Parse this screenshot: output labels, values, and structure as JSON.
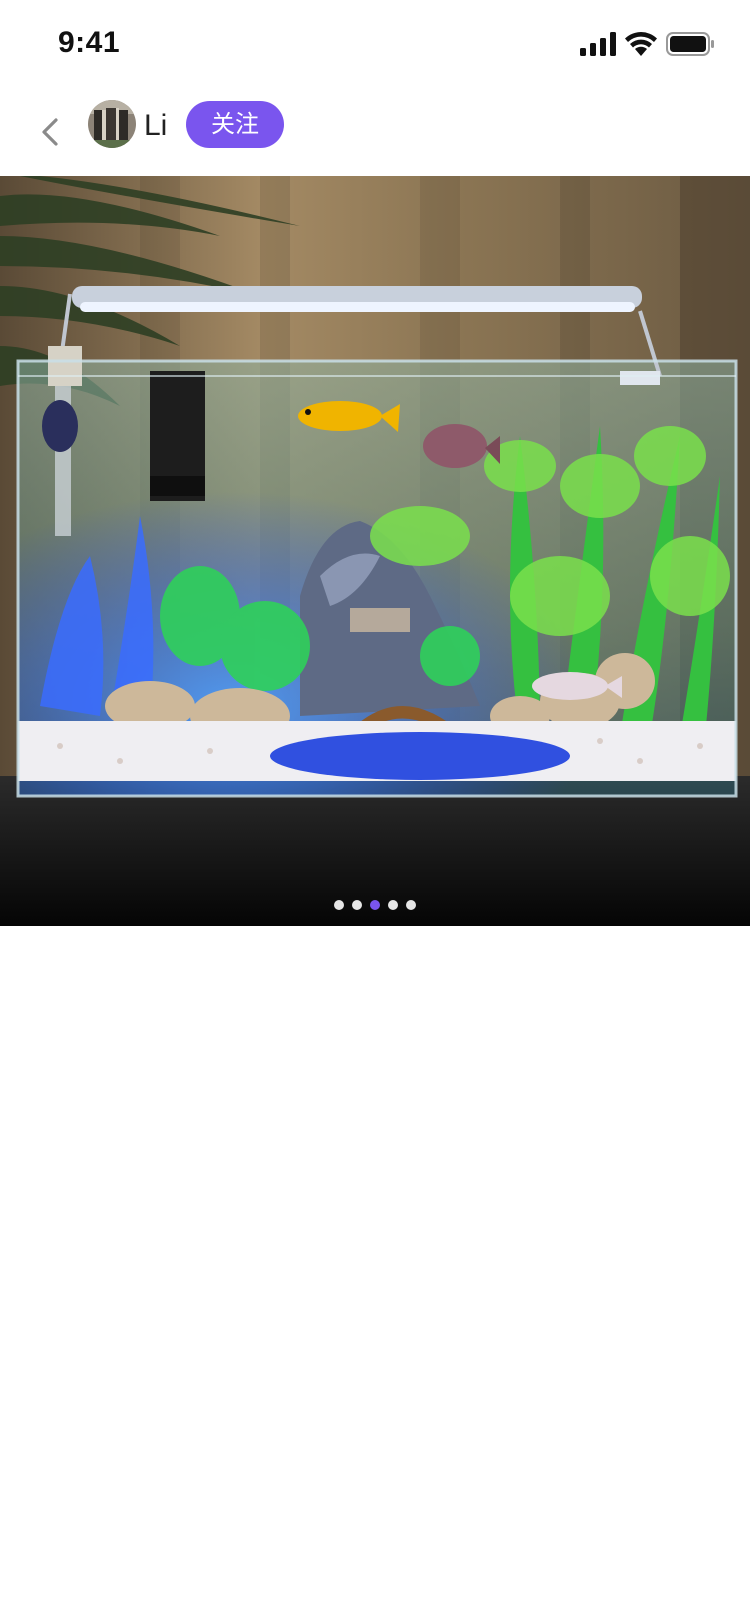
{
  "status_bar": {
    "time": "9:41",
    "icons": [
      "signal-icon",
      "wifi-icon",
      "battery-icon"
    ]
  },
  "header": {
    "back_icon": "back-icon",
    "user_name": "Li",
    "follow_label": "关注"
  },
  "carousel": {
    "image": "aquarium-photo",
    "slide_count": 5,
    "active_index": 2
  },
  "colors": {
    "accent": "#7a55ee",
    "dot_inactive": "#e6e6e6"
  }
}
